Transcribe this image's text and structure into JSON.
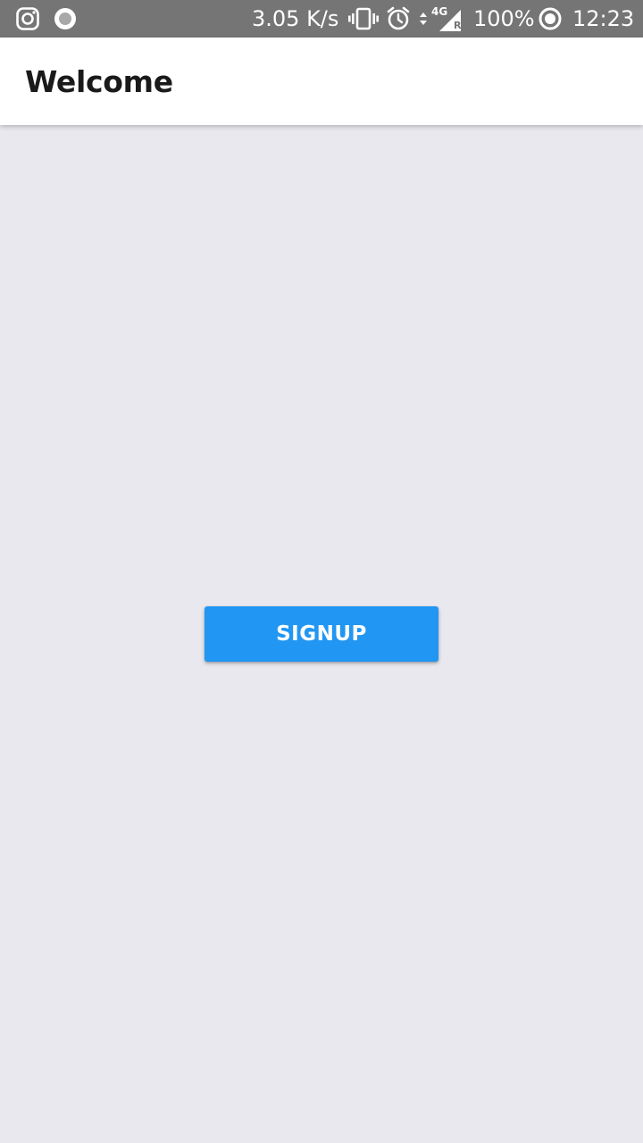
{
  "status_bar": {
    "left_icons": [
      "instagram-icon",
      "record-dot-icon"
    ],
    "network_speed": "3.05 K/s",
    "right_icons": [
      "vibrate-icon",
      "alarm-icon",
      "data-arrows-icon",
      "signal-4g-icon"
    ],
    "network_type": "4G",
    "roaming": "R",
    "battery": "100%",
    "time": "12:23"
  },
  "app_bar": {
    "title": "Welcome"
  },
  "main": {
    "signup_label": "SIGNUP"
  },
  "colors": {
    "status_bar": "#757575",
    "app_bar": "#ffffff",
    "background": "#e8e8ee",
    "button": "#2196f3",
    "button_text": "#ffffff",
    "title_text": "#1a1a1a"
  }
}
